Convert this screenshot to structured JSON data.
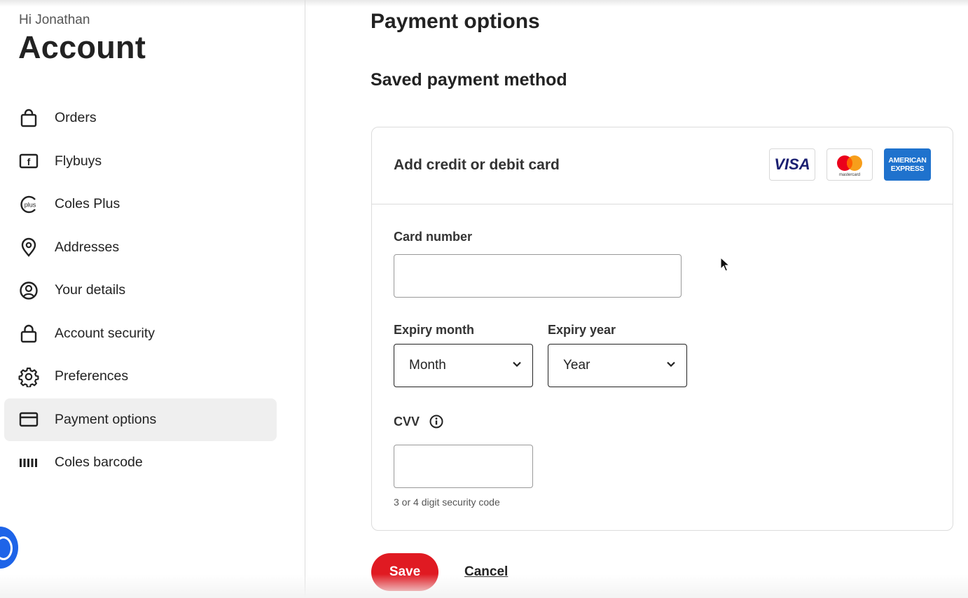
{
  "sidebar": {
    "greeting": "Hi Jonathan",
    "title": "Account",
    "items": [
      {
        "label": "Orders",
        "icon": "shopping-bag-icon"
      },
      {
        "label": "Flybuys",
        "icon": "flybuys-icon"
      },
      {
        "label": "Coles Plus",
        "icon": "coles-plus-icon"
      },
      {
        "label": "Addresses",
        "icon": "location-pin-icon"
      },
      {
        "label": "Your details",
        "icon": "user-circle-icon"
      },
      {
        "label": "Account security",
        "icon": "lock-icon"
      },
      {
        "label": "Preferences",
        "icon": "gear-icon"
      },
      {
        "label": "Payment options",
        "icon": "credit-card-icon",
        "active": true
      },
      {
        "label": "Coles barcode",
        "icon": "barcode-icon"
      }
    ],
    "plus_icon_text": "plus",
    "flybuys_icon_text": "f"
  },
  "main": {
    "page_title": "Payment options",
    "section_title": "Saved payment method",
    "panel": {
      "header_title": "Add credit or debit card",
      "logos": {
        "visa": "VISA",
        "mastercard": "mastercard",
        "amex_line1": "AMERICAN",
        "amex_line2": "EXPRESS"
      },
      "card_number": {
        "label": "Card number",
        "value": ""
      },
      "expiry_month": {
        "label": "Expiry month",
        "selected": "Month"
      },
      "expiry_year": {
        "label": "Expiry year",
        "selected": "Year"
      },
      "cvv": {
        "label": "CVV",
        "value": "",
        "hint": "3 or 4 digit security code"
      }
    },
    "actions": {
      "save": "Save",
      "cancel": "Cancel"
    }
  },
  "colors": {
    "brand_red": "#e01a22",
    "active_nav_bg": "#efefef",
    "help_blue": "#1e64e8",
    "amex_blue": "#1f72cd",
    "visa_navy": "#1a1f71"
  }
}
